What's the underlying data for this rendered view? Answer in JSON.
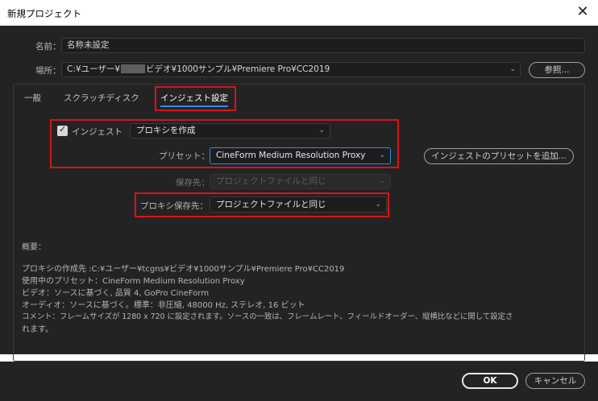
{
  "window": {
    "title": "新規プロジェクト",
    "close_glyph": "✕"
  },
  "name_row": {
    "label": "名前：",
    "value": "名称未設定"
  },
  "location_row": {
    "label": "場所：",
    "value_prefix": "C:¥ユーザー¥",
    "value_suffix": "ビデオ¥1000サンプル¥Premiere Pro¥CC2019",
    "browse_label": "参照..."
  },
  "tabs": [
    {
      "label": "一般"
    },
    {
      "label": "スクラッチディスク"
    },
    {
      "label": "インジェスト設定",
      "active": true
    }
  ],
  "ingest": {
    "checkbox_label": "インジェスト",
    "checked": true,
    "mode_value": "プロキシを作成",
    "preset_label": "プリセット：",
    "preset_value": "CineForm Medium Resolution Proxy",
    "add_preset_label": "インジェストのプリセットを追加...",
    "dest_label": "保存先：",
    "dest_value": "プロジェクトファイルと同じ",
    "proxy_dest_label": "プロキシ保存先：",
    "proxy_dest_value": "プロジェクトファイルと同じ"
  },
  "summary": {
    "heading": "概要：",
    "lines": [
      "プロキシの作成先 :C:¥ユーザー¥tcgns¥ビデオ¥1000サンプル¥Premiere Pro¥CC2019",
      "使用中のプリセット：CineForm Medium Resolution Proxy",
      "ビデオ：ソースに基づく, 品質 4, GoPro CineForm",
      "オーディオ：ソースに基づく。標準：非圧縮, 48000 Hz, ステレオ, 16 ビット",
      "コメント：フレームサイズが 1280 x 720 に設定されます。ソースの一致は、フレームレート、フィールドオーダー、縦横比などに関して設定さ",
      "れます。"
    ]
  },
  "footer": {
    "ok_label": "OK",
    "cancel_label": "キャンセル"
  },
  "colors": {
    "dialog_bg": "#232323",
    "accent": "#2d8ceb",
    "highlight_red": "#d8141b"
  }
}
